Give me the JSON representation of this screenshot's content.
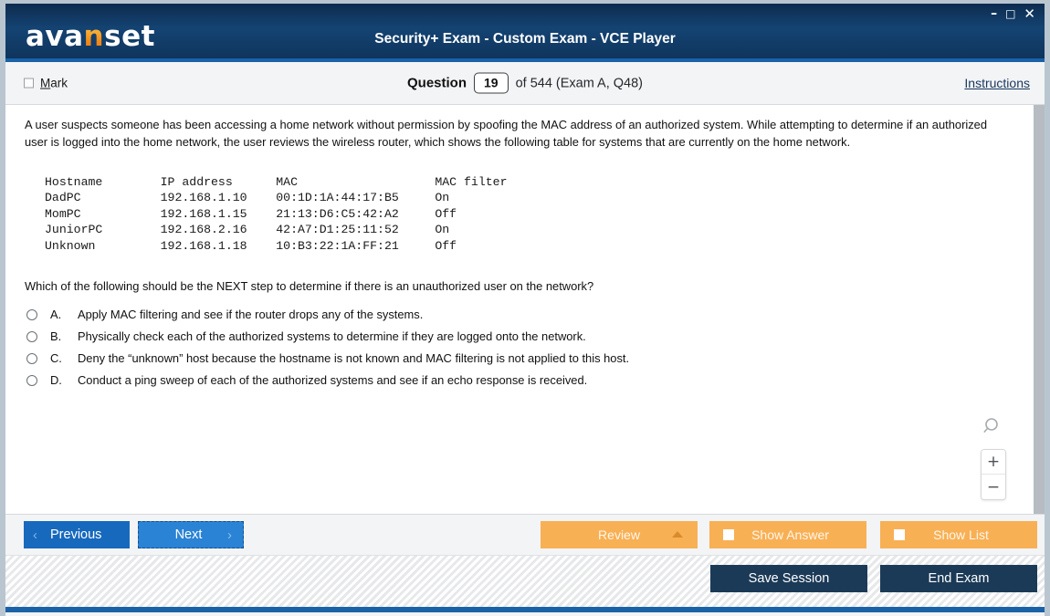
{
  "window": {
    "logo_prefix": "ava",
    "logo_accent": "n",
    "logo_suffix": "set",
    "title": "Security+ Exam - Custom Exam - VCE Player",
    "minimize": "–",
    "maximize": "□",
    "close": "✕",
    "colors": {
      "titlebar_dark": "#0d2c4e",
      "titlebar_mid": "#144373",
      "accent_blue": "#1a62a8",
      "logo_orange": "#f0901c",
      "button_blue": "#1769bd",
      "button_blue_light": "#2a83d4",
      "orange": "#f8b055",
      "navy_button": "#1b3a57"
    }
  },
  "header": {
    "mark_label_accel": "M",
    "mark_label_rest": "ark",
    "question_word": "Question",
    "question_number": "19",
    "question_of": "of 544 (Exam A, Q48)",
    "instructions": "Instructions"
  },
  "question": {
    "stem": "A user suspects someone has been accessing a home network without permission by spoofing the MAC address of an authorized system. While attempting to determine if an authorized user is logged into the home network, the user reviews the wireless router, which shows the following table for systems that are currently on the home network.",
    "table_text": "Hostname        IP address      MAC                   MAC filter\nDadPC           192.168.1.10    00:1D:1A:44:17:B5     On\nMomPC           192.168.1.15    21:13:D6:C5:42:A2     Off\nJuniorPC        192.168.2.16    42:A7:D1:25:11:52     On\nUnknown         192.168.1.18    10:B3:22:1A:FF:21     Off",
    "table_columns": [
      "Hostname",
      "IP address",
      "MAC",
      "MAC filter"
    ],
    "table_rows": [
      [
        "DadPC",
        "192.168.1.10",
        "00:1D:1A:44:17:B5",
        "On"
      ],
      [
        "MomPC",
        "192.168.1.15",
        "21:13:D6:C5:42:A2",
        "Off"
      ],
      [
        "JuniorPC",
        "192.168.2.16",
        "42:A7:D1:25:11:52",
        "On"
      ],
      [
        "Unknown",
        "192.168.1.18",
        "10:B3:22:1A:FF:21",
        "Off"
      ]
    ],
    "prompt": "Which of the following should be the NEXT step to determine if there is an unauthorized user on the network?",
    "options": [
      {
        "letter": "A.",
        "text": "Apply MAC filtering and see if the router drops any of the systems.",
        "selected": false
      },
      {
        "letter": "B.",
        "text": "Physically check each of the authorized systems to determine if they are logged onto the network.",
        "selected": false
      },
      {
        "letter": "C.",
        "text": "Deny the “unknown” host because the hostname is not known and MAC filtering is not applied to this host.",
        "selected": false
      },
      {
        "letter": "D.",
        "text": "Conduct a ping sweep of each of the authorized systems and see if an echo response is received.",
        "selected": false
      }
    ]
  },
  "zoom_widget": {
    "zoom_in": "+",
    "zoom_out": "−"
  },
  "nav": {
    "previous": "Previous",
    "previous_chevron": "‹",
    "next": "Next",
    "next_chevron": "›",
    "review": "Review",
    "show_answer": "Show Answer",
    "show_list": "Show List"
  },
  "footer": {
    "save_session": "Save Session",
    "end_exam": "End Exam"
  }
}
